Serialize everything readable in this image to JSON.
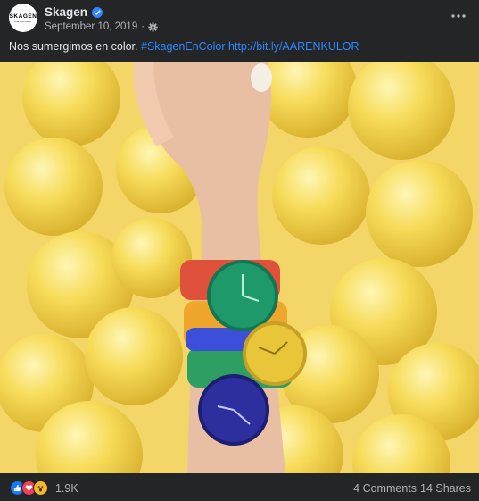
{
  "post": {
    "page_name": "Skagen",
    "date": "September 10, 2019",
    "separator": "·",
    "avatar": {
      "brand": "SKAGEN",
      "sub": "DENMARK"
    },
    "caption_text": "Nos sumergimos en color. ",
    "hashtag": "#SkagenEnColor",
    "link": "http://bit.ly/AARENKULOR",
    "photo_icon": "photo-of-hand-wearing-colorful-watches-in-yellow-ball-pit",
    "reaction_count": "1.9K",
    "comments": "4 Comments",
    "shares": "14 Shares",
    "colors": {
      "background": "#242526",
      "text": "#e4e6eb",
      "secondary": "#b0b3b8",
      "link": "#2d88ff",
      "photo_bg": "#f1d460"
    },
    "reaction_icons": [
      "like-icon",
      "love-icon",
      "wow-icon"
    ]
  }
}
